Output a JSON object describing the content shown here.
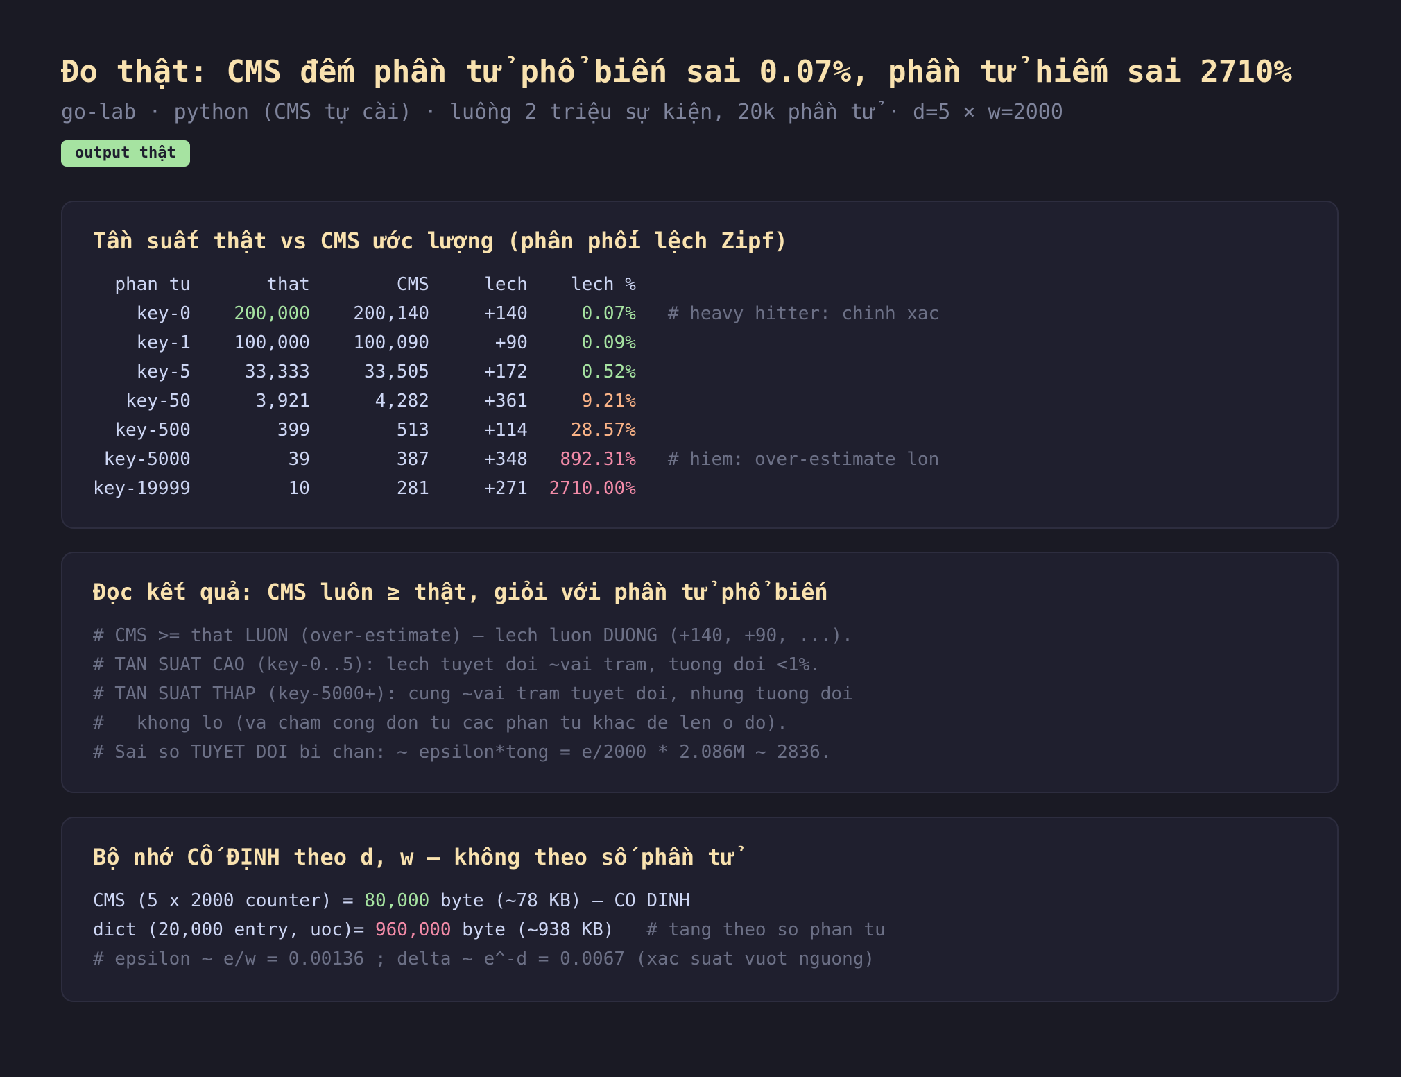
{
  "header": {
    "title": "Đo thật: CMS đếm phần tử phổ biến sai 0.07%, phần tử hiếm sai 2710%",
    "subtitle": "go-lab · python (CMS tự cài) · luồng 2 triệu sự kiện, 20k phần tử · d=5 × w=2000",
    "badge": "output thật"
  },
  "colors": {
    "background": "#1a1a24",
    "card": "#1f1f2e",
    "title": "#f9e2af",
    "green": "#a6e3a1",
    "orange": "#fab387",
    "red": "#f38ba8",
    "muted": "#6c7086"
  },
  "table_card": {
    "title": "Tần suất thật vs CMS ước lượng (phân phối lệch Zipf)",
    "columns": [
      "phan tu",
      "that",
      "CMS",
      "lech",
      "lech %"
    ],
    "rows": [
      {
        "key": "key-0",
        "that": "200,000",
        "cms": "200,140",
        "lech": "+140",
        "pct": "0.07%",
        "note": "# heavy hitter: chinh xac"
      },
      {
        "key": "key-1",
        "that": "100,000",
        "cms": "100,090",
        "lech": "+90",
        "pct": "0.09%",
        "note": ""
      },
      {
        "key": "key-5",
        "that": "33,333",
        "cms": "33,505",
        "lech": "+172",
        "pct": "0.52%",
        "note": ""
      },
      {
        "key": "key-50",
        "that": "3,921",
        "cms": "4,282",
        "lech": "+361",
        "pct": "9.21%",
        "note": ""
      },
      {
        "key": "key-500",
        "that": "399",
        "cms": "513",
        "lech": "+114",
        "pct": "28.57%",
        "note": ""
      },
      {
        "key": "key-5000",
        "that": "39",
        "cms": "387",
        "lech": "+348",
        "pct": "892.31%",
        "note": "# hiem: over-estimate lon"
      },
      {
        "key": "key-19999",
        "that": "10",
        "cms": "281",
        "lech": "+271",
        "pct": "2710.00%",
        "note": ""
      }
    ]
  },
  "result_card": {
    "title": "Đọc kết quả: CMS luôn ≥ thật, giỏi với phần tử phổ biến",
    "lines": [
      "# CMS >= that LUON (over-estimate) — lech luon DUONG (+140, +90, ...).",
      "# TAN SUAT CAO (key-0..5): lech tuyet doi ~vai tram, tuong doi <1%.",
      "# TAN SUAT THAP (key-5000+): cung ~vai tram tuyet doi, nhung tuong doi",
      "#   khong lo (va cham cong don tu cac phan tu khac de len o do).",
      "# Sai so TUYET DOI bi chan: ~ epsilon*tong = e/2000 * 2.086M ~ 2836."
    ]
  },
  "memory_card": {
    "title": "Bộ nhớ CỐ ĐỊNH theo d, w — không theo số phần tử",
    "line1": {
      "prefix": "CMS (5 x 2000 counter) = ",
      "value": "80,000",
      "suffix": " byte (~78 KB) — CO DINH"
    },
    "line2": {
      "prefix": "dict (20,000 entry, uoc)= ",
      "value": "960,000",
      "suffix": " byte (~938 KB)",
      "comment": "   # tang theo so phan tu"
    },
    "line3": "# epsilon ~ e/w = 0.00136 ; delta ~ e^-d = 0.0067 (xac suat vuot nguong)"
  }
}
